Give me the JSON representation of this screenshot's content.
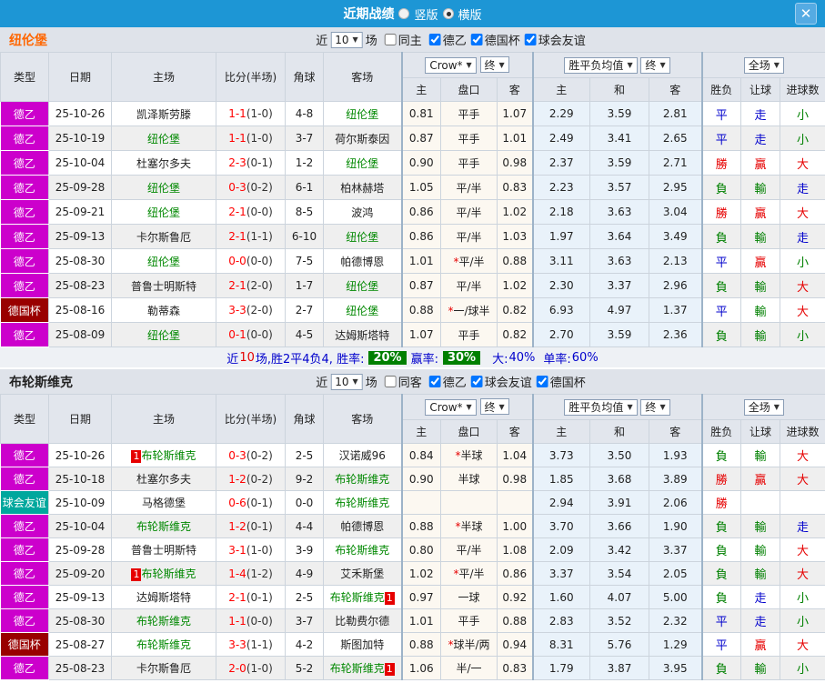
{
  "colors": {
    "bar": "#1d96d5",
    "de2": "#cc00cc",
    "cup": "#990000",
    "friendly": "#00a79d",
    "team": "#008800",
    "score": "#ff0000",
    "red": "#e60000",
    "blue": "#0000cc",
    "green": "#008000"
  },
  "titlebar": {
    "title": "近期战绩",
    "radio_vertical": "竖版",
    "radio_horizontal": "横版",
    "close": "✕"
  },
  "sections": [
    {
      "team": "纽伦堡",
      "team_color": "#ff6600",
      "filter": {
        "near": "近",
        "rounds": "10",
        "games": "场",
        "same": {
          "label": "同主",
          "checked": false
        },
        "leagues": [
          {
            "label": "德乙",
            "checked": true
          },
          {
            "label": "德国杯",
            "checked": true
          },
          {
            "label": "球会友谊",
            "checked": true
          }
        ]
      },
      "header": {
        "type": "类型",
        "date": "日期",
        "home": "主场",
        "score": "比分(半场)",
        "corner": "角球",
        "away": "客场",
        "odds_select": "Crow*",
        "final1": "终",
        "avg_select": "胜平负均值",
        "final2": "终",
        "scope_select": "全场",
        "odds_home": "主",
        "odds_hcap": "盘口",
        "odds_away": "客",
        "avg_home": "主",
        "avg_draw": "和",
        "avg_away": "客",
        "wl": "胜负",
        "hcp": "让球",
        "goals": "进球数"
      },
      "rows": [
        {
          "type": "德乙",
          "type_cls": "lg-de2",
          "date": "25-10-26",
          "home": "凯泽斯劳滕",
          "home_green": false,
          "home_badge": "",
          "score": "1-1",
          "half": "(1-0)",
          "corner": "4-8",
          "away": "纽伦堡",
          "away_green": true,
          "away_badge": "",
          "o1": "0.81",
          "star": "",
          "hcap": "平手",
          "o2": "1.07",
          "a1": "2.29",
          "a2": "3.59",
          "a3": "2.81",
          "wl": "平",
          "wl_cls": "b",
          "hc": "走",
          "hc_cls": "b",
          "gl": "小",
          "gl_cls": "g"
        },
        {
          "type": "德乙",
          "type_cls": "lg-de2",
          "date": "25-10-19",
          "home": "纽伦堡",
          "home_green": true,
          "home_badge": "",
          "score": "1-1",
          "half": "(1-0)",
          "corner": "3-7",
          "away": "荷尔斯泰因",
          "away_green": false,
          "away_badge": "",
          "o1": "0.87",
          "star": "",
          "hcap": "平手",
          "o2": "1.01",
          "a1": "2.49",
          "a2": "3.41",
          "a3": "2.65",
          "wl": "平",
          "wl_cls": "b",
          "hc": "走",
          "hc_cls": "b",
          "gl": "小",
          "gl_cls": "g"
        },
        {
          "type": "德乙",
          "type_cls": "lg-de2",
          "date": "25-10-04",
          "home": "杜塞尔多夫",
          "home_green": false,
          "home_badge": "",
          "score": "2-3",
          "half": "(0-1)",
          "corner": "1-2",
          "away": "纽伦堡",
          "away_green": true,
          "away_badge": "",
          "o1": "0.90",
          "star": "",
          "hcap": "平手",
          "o2": "0.98",
          "a1": "2.37",
          "a2": "3.59",
          "a3": "2.71",
          "wl": "勝",
          "wl_cls": "r",
          "hc": "贏",
          "hc_cls": "r",
          "gl": "大",
          "gl_cls": "r"
        },
        {
          "type": "德乙",
          "type_cls": "lg-de2",
          "date": "25-09-28",
          "home": "纽伦堡",
          "home_green": true,
          "home_badge": "",
          "score": "0-3",
          "half": "(0-2)",
          "corner": "6-1",
          "away": "柏林赫塔",
          "away_green": false,
          "away_badge": "",
          "o1": "1.05",
          "star": "",
          "hcap": "平/半",
          "o2": "0.83",
          "a1": "2.23",
          "a2": "3.57",
          "a3": "2.95",
          "wl": "負",
          "wl_cls": "g",
          "hc": "輸",
          "hc_cls": "g",
          "gl": "走",
          "gl_cls": "b"
        },
        {
          "type": "德乙",
          "type_cls": "lg-de2",
          "date": "25-09-21",
          "home": "纽伦堡",
          "home_green": true,
          "home_badge": "",
          "score": "2-1",
          "half": "(0-0)",
          "corner": "8-5",
          "away": "波鸿",
          "away_green": false,
          "away_badge": "",
          "o1": "0.86",
          "star": "",
          "hcap": "平/半",
          "o2": "1.02",
          "a1": "2.18",
          "a2": "3.63",
          "a3": "3.04",
          "wl": "勝",
          "wl_cls": "r",
          "hc": "贏",
          "hc_cls": "r",
          "gl": "大",
          "gl_cls": "r"
        },
        {
          "type": "德乙",
          "type_cls": "lg-de2",
          "date": "25-09-13",
          "home": "卡尔斯鲁厄",
          "home_green": false,
          "home_badge": "",
          "score": "2-1",
          "half": "(1-1)",
          "corner": "6-10",
          "away": "纽伦堡",
          "away_green": true,
          "away_badge": "",
          "o1": "0.86",
          "star": "",
          "hcap": "平/半",
          "o2": "1.03",
          "a1": "1.97",
          "a2": "3.64",
          "a3": "3.49",
          "wl": "負",
          "wl_cls": "g",
          "hc": "輸",
          "hc_cls": "g",
          "gl": "走",
          "gl_cls": "b"
        },
        {
          "type": "德乙",
          "type_cls": "lg-de2",
          "date": "25-08-30",
          "home": "纽伦堡",
          "home_green": true,
          "home_badge": "",
          "score": "0-0",
          "half": "(0-0)",
          "corner": "7-5",
          "away": "帕德博恩",
          "away_green": false,
          "away_badge": "",
          "o1": "1.01",
          "star": "*",
          "hcap": "平/半",
          "o2": "0.88",
          "a1": "3.11",
          "a2": "3.63",
          "a3": "2.13",
          "wl": "平",
          "wl_cls": "b",
          "hc": "贏",
          "hc_cls": "r",
          "gl": "小",
          "gl_cls": "g"
        },
        {
          "type": "德乙",
          "type_cls": "lg-de2",
          "date": "25-08-23",
          "home": "普鲁士明斯特",
          "home_green": false,
          "home_badge": "",
          "score": "2-1",
          "half": "(2-0)",
          "corner": "1-7",
          "away": "纽伦堡",
          "away_green": true,
          "away_badge": "",
          "o1": "0.87",
          "star": "",
          "hcap": "平/半",
          "o2": "1.02",
          "a1": "2.30",
          "a2": "3.37",
          "a3": "2.96",
          "wl": "負",
          "wl_cls": "g",
          "hc": "輸",
          "hc_cls": "g",
          "gl": "大",
          "gl_cls": "r"
        },
        {
          "type": "德国杯",
          "type_cls": "lg-cup",
          "date": "25-08-16",
          "home": "勒蒂森",
          "home_green": false,
          "home_badge": "",
          "score": "3-3",
          "half": "(2-0)",
          "corner": "2-7",
          "away": "纽伦堡",
          "away_green": true,
          "away_badge": "",
          "o1": "0.88",
          "star": "*",
          "hcap": "一/球半",
          "o2": "0.82",
          "a1": "6.93",
          "a2": "4.97",
          "a3": "1.37",
          "wl": "平",
          "wl_cls": "b",
          "hc": "輸",
          "hc_cls": "g",
          "gl": "大",
          "gl_cls": "r"
        },
        {
          "type": "德乙",
          "type_cls": "lg-de2",
          "date": "25-08-09",
          "home": "纽伦堡",
          "home_green": true,
          "home_badge": "",
          "score": "0-1",
          "half": "(0-0)",
          "corner": "4-5",
          "away": "达姆斯塔特",
          "away_green": false,
          "away_badge": "",
          "o1": "1.07",
          "star": "",
          "hcap": "平手",
          "o2": "0.82",
          "a1": "2.70",
          "a2": "3.59",
          "a3": "2.36",
          "wl": "負",
          "wl_cls": "g",
          "hc": "輸",
          "hc_cls": "g",
          "gl": "小",
          "gl_cls": "g"
        }
      ],
      "summary": {
        "t1": "近",
        "t2": "10",
        "t3": "场,胜2平4负4, 胜率:",
        "b1": "20%",
        "t4": "赢率:",
        "b2": "30%",
        "t5": "大:",
        "t6": "40%",
        "t7": "单率:",
        "t8": "60%"
      }
    },
    {
      "team": "布轮斯维克",
      "team_color": "#222222",
      "filter": {
        "near": "近",
        "rounds": "10",
        "games": "场",
        "same": {
          "label": "同客",
          "checked": false
        },
        "leagues": [
          {
            "label": "德乙",
            "checked": true
          },
          {
            "label": "球会友谊",
            "checked": true
          },
          {
            "label": "德国杯",
            "checked": true
          }
        ]
      },
      "header": {
        "type": "类型",
        "date": "日期",
        "home": "主场",
        "score": "比分(半场)",
        "corner": "角球",
        "away": "客场",
        "odds_select": "Crow*",
        "final1": "终",
        "avg_select": "胜平负均值",
        "final2": "终",
        "scope_select": "全场",
        "odds_home": "主",
        "odds_hcap": "盘口",
        "odds_away": "客",
        "avg_home": "主",
        "avg_draw": "和",
        "avg_away": "客",
        "wl": "胜负",
        "hcp": "让球",
        "goals": "进球数"
      },
      "rows": [
        {
          "type": "德乙",
          "type_cls": "lg-de2",
          "date": "25-10-26",
          "home": "布轮斯维克",
          "home_green": true,
          "home_badge": "1",
          "score": "0-3",
          "half": "(0-2)",
          "corner": "2-5",
          "away": "汉诺威96",
          "away_green": false,
          "away_badge": "",
          "o1": "0.84",
          "star": "*",
          "hcap": "半球",
          "o2": "1.04",
          "a1": "3.73",
          "a2": "3.50",
          "a3": "1.93",
          "wl": "負",
          "wl_cls": "g",
          "hc": "輸",
          "hc_cls": "g",
          "gl": "大",
          "gl_cls": "r"
        },
        {
          "type": "德乙",
          "type_cls": "lg-de2",
          "date": "25-10-18",
          "home": "杜塞尔多夫",
          "home_green": false,
          "home_badge": "",
          "score": "1-2",
          "half": "(0-2)",
          "corner": "9-2",
          "away": "布轮斯维克",
          "away_green": true,
          "away_badge": "",
          "o1": "0.90",
          "star": "",
          "hcap": "半球",
          "o2": "0.98",
          "a1": "1.85",
          "a2": "3.68",
          "a3": "3.89",
          "wl": "勝",
          "wl_cls": "r",
          "hc": "贏",
          "hc_cls": "r",
          "gl": "大",
          "gl_cls": "r"
        },
        {
          "type": "球会友谊",
          "type_cls": "lg-friendly",
          "date": "25-10-09",
          "home": "马格德堡",
          "home_green": false,
          "home_badge": "",
          "score": "0-6",
          "half": "(0-1)",
          "corner": "0-0",
          "away": "布轮斯维克",
          "away_green": true,
          "away_badge": "",
          "o1": "",
          "star": "",
          "hcap": "",
          "o2": "",
          "a1": "2.94",
          "a2": "3.91",
          "a3": "2.06",
          "wl": "勝",
          "wl_cls": "r",
          "hc": "",
          "hc_cls": "",
          "gl": "",
          "gl_cls": ""
        },
        {
          "type": "德乙",
          "type_cls": "lg-de2",
          "date": "25-10-04",
          "home": "布轮斯维克",
          "home_green": true,
          "home_badge": "",
          "score": "1-2",
          "half": "(0-1)",
          "corner": "4-4",
          "away": "帕德博恩",
          "away_green": false,
          "away_badge": "",
          "o1": "0.88",
          "star": "*",
          "hcap": "半球",
          "o2": "1.00",
          "a1": "3.70",
          "a2": "3.66",
          "a3": "1.90",
          "wl": "負",
          "wl_cls": "g",
          "hc": "輸",
          "hc_cls": "g",
          "gl": "走",
          "gl_cls": "b"
        },
        {
          "type": "德乙",
          "type_cls": "lg-de2",
          "date": "25-09-28",
          "home": "普鲁士明斯特",
          "home_green": false,
          "home_badge": "",
          "score": "3-1",
          "half": "(1-0)",
          "corner": "3-9",
          "away": "布轮斯维克",
          "away_green": true,
          "away_badge": "",
          "o1": "0.80",
          "star": "",
          "hcap": "平/半",
          "o2": "1.08",
          "a1": "2.09",
          "a2": "3.42",
          "a3": "3.37",
          "wl": "負",
          "wl_cls": "g",
          "hc": "輸",
          "hc_cls": "g",
          "gl": "大",
          "gl_cls": "r"
        },
        {
          "type": "德乙",
          "type_cls": "lg-de2",
          "date": "25-09-20",
          "home": "布轮斯维克",
          "home_green": true,
          "home_badge": "1",
          "score": "1-4",
          "half": "(1-2)",
          "corner": "4-9",
          "away": "艾禾斯堡",
          "away_green": false,
          "away_badge": "",
          "o1": "1.02",
          "star": "*",
          "hcap": "平/半",
          "o2": "0.86",
          "a1": "3.37",
          "a2": "3.54",
          "a3": "2.05",
          "wl": "負",
          "wl_cls": "g",
          "hc": "輸",
          "hc_cls": "g",
          "gl": "大",
          "gl_cls": "r"
        },
        {
          "type": "德乙",
          "type_cls": "lg-de2",
          "date": "25-09-13",
          "home": "达姆斯塔特",
          "home_green": false,
          "home_badge": "",
          "score": "2-1",
          "half": "(0-1)",
          "corner": "2-5",
          "away": "布轮斯维克",
          "away_green": true,
          "away_badge": "1",
          "o1": "0.97",
          "star": "",
          "hcap": "一球",
          "o2": "0.92",
          "a1": "1.60",
          "a2": "4.07",
          "a3": "5.00",
          "wl": "負",
          "wl_cls": "g",
          "hc": "走",
          "hc_cls": "b",
          "gl": "小",
          "gl_cls": "g"
        },
        {
          "type": "德乙",
          "type_cls": "lg-de2",
          "date": "25-08-30",
          "home": "布轮斯维克",
          "home_green": true,
          "home_badge": "",
          "score": "1-1",
          "half": "(0-0)",
          "corner": "3-7",
          "away": "比勒费尔德",
          "away_green": false,
          "away_badge": "",
          "o1": "1.01",
          "star": "",
          "hcap": "平手",
          "o2": "0.88",
          "a1": "2.83",
          "a2": "3.52",
          "a3": "2.32",
          "wl": "平",
          "wl_cls": "b",
          "hc": "走",
          "hc_cls": "b",
          "gl": "小",
          "gl_cls": "g"
        },
        {
          "type": "德国杯",
          "type_cls": "lg-cup",
          "date": "25-08-27",
          "home": "布轮斯维克",
          "home_green": true,
          "home_badge": "",
          "score": "3-3",
          "half": "(1-1)",
          "corner": "4-2",
          "away": "斯图加特",
          "away_green": false,
          "away_badge": "",
          "o1": "0.88",
          "star": "*",
          "hcap": "球半/两",
          "o2": "0.94",
          "a1": "8.31",
          "a2": "5.76",
          "a3": "1.29",
          "wl": "平",
          "wl_cls": "b",
          "hc": "贏",
          "hc_cls": "r",
          "gl": "大",
          "gl_cls": "r"
        },
        {
          "type": "德乙",
          "type_cls": "lg-de2",
          "date": "25-08-23",
          "home": "卡尔斯鲁厄",
          "home_green": false,
          "home_badge": "",
          "score": "2-0",
          "half": "(1-0)",
          "corner": "5-2",
          "away": "布轮斯维克",
          "away_green": true,
          "away_badge": "1",
          "o1": "1.06",
          "star": "",
          "hcap": "半/一",
          "o2": "0.83",
          "a1": "1.79",
          "a2": "3.87",
          "a3": "3.95",
          "wl": "負",
          "wl_cls": "g",
          "hc": "輸",
          "hc_cls": "g",
          "gl": "小",
          "gl_cls": "g"
        }
      ],
      "summary": null
    }
  ]
}
